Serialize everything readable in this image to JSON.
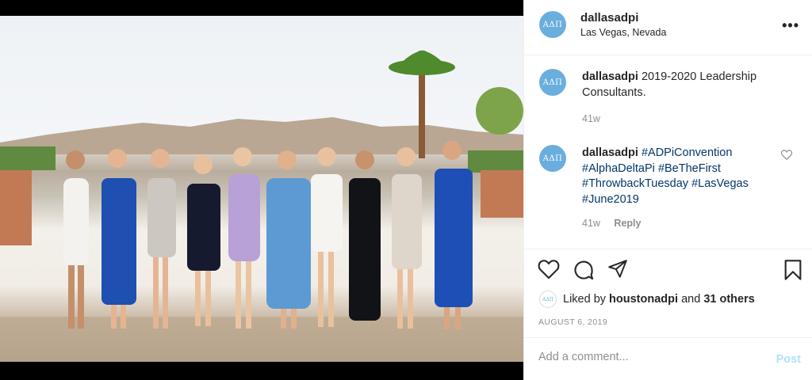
{
  "post": {
    "header": {
      "username": "dallasadpi",
      "location": "Las Vegas, Nevada",
      "avatar_text": "ΑΔΠ",
      "more_label": "•••"
    },
    "comments": [
      {
        "username": "dallasadpi",
        "text": "2019-2020 Leadership Consultants.",
        "time": "41w"
      },
      {
        "username": "dallasadpi",
        "hashtags": [
          "#ADPiConvention",
          "#AlphaDeltaPi",
          "#BeTheFirst",
          "#ThrowbackTuesday",
          "#LasVegas",
          "#June2019"
        ],
        "time": "41w",
        "reply_label": "Reply"
      }
    ],
    "likes": {
      "prefix": "Liked by",
      "user": "houstonadpi",
      "conjunction": "and",
      "others": "31 others",
      "mini_avatar_text": "ΑΔΠ"
    },
    "date": "AUGUST 6, 2019",
    "add_comment": {
      "placeholder": "Add a comment...",
      "post_label": "Post"
    }
  },
  "colors": {
    "avatar": "#6aaede",
    "hashtag": "#00376b",
    "meta": "#8e8e8e",
    "post_disabled": "#b2dffc"
  },
  "icons": [
    "heart-icon",
    "comment-icon",
    "share-icon",
    "bookmark-icon",
    "more-icon"
  ]
}
